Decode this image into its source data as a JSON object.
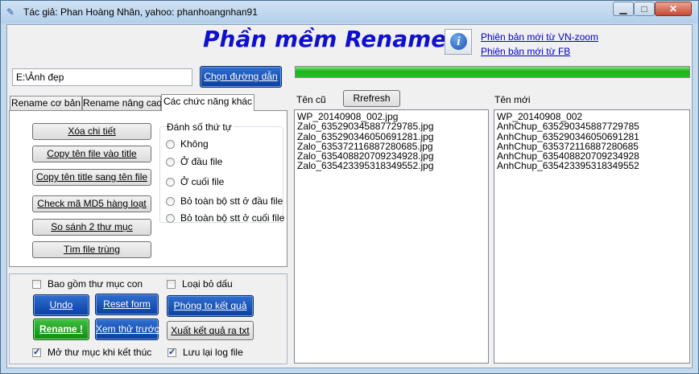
{
  "window": {
    "title": "Tác giả: Phan Hoàng Nhân, yahoo: phanhoangnhan91",
    "controls": {
      "minimize": "▁",
      "maximize": "□",
      "close": "✕"
    }
  },
  "header": {
    "app_title": "Phần mềm Rename",
    "info_icon": "i",
    "links": [
      "Phiên bản mới từ VN-zoom",
      "Phiên bản mới từ FB"
    ]
  },
  "path": {
    "value": "E:\\Ảnh đẹp",
    "choose_button": "Chọn đường dẫn",
    "progress_percent": 100
  },
  "tabs": [
    {
      "label": "Rename cơ bản",
      "active": false
    },
    {
      "label": "Rename nâng cao",
      "active": false
    },
    {
      "label": "Các chức năng khác",
      "active": true
    }
  ],
  "tools": {
    "buttons": [
      "Xóa chi tiết",
      "Copy tên file vào title",
      "Copy tên title sang tên file",
      "Check mã MD5 hàng loạt",
      "So sánh 2 thư mục",
      "Tìm file trùng"
    ]
  },
  "numbering": {
    "legend": "Đánh số thứ tự",
    "options": [
      "Không",
      "Ở đầu file",
      "Ở cuối file",
      "Bỏ toàn bộ stt ở đầu file",
      "Bỏ toàn bộ stt ở cuối file"
    ]
  },
  "options": {
    "include_subfolders": {
      "label": "Bao gồm thư mục con",
      "checked": false
    },
    "remove_accents": {
      "label": "Loại bỏ dấu",
      "checked": false
    },
    "open_folder_after": {
      "label": "Mở thư mục khi kết thúc",
      "checked": true
    },
    "save_log": {
      "label": "Lưu lại log file",
      "checked": true
    }
  },
  "actions": {
    "undo": "Undo",
    "reset_form": "Reset form",
    "zoom_result": "Phóng to kết quả",
    "rename": "Rename !",
    "preview": "Xem thử trước",
    "export_txt": "Xuất kết quả ra txt"
  },
  "old_names": {
    "label": "Tên cũ",
    "refresh": "Rrefresh",
    "items": [
      "WP_20140908_002.jpg",
      "Zalo_635290345887729785.jpg",
      "Zalo_635290346050691281.jpg",
      "Zalo_635372116887280685.jpg",
      "Zalo_635408820709234928.jpg",
      "Zalo_635423395318349552.jpg"
    ]
  },
  "new_names": {
    "label": "Tên mới",
    "items": [
      "WP_20140908_002",
      "AnhChup_635290345887729785",
      "AnhChup_635290346050691281",
      "AnhChup_635372116887280685",
      "AnhChup_635408820709234928",
      "AnhChup_635423395318349552"
    ]
  }
}
